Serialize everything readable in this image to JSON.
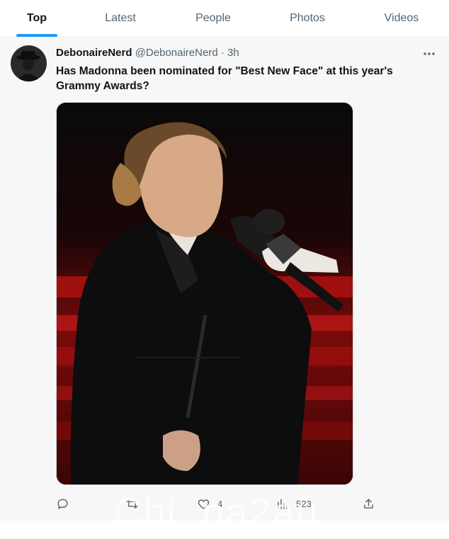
{
  "tabs": [
    {
      "label": "Top",
      "active": true
    },
    {
      "label": "Latest",
      "active": false
    },
    {
      "label": "People",
      "active": false
    },
    {
      "label": "Photos",
      "active": false
    },
    {
      "label": "Videos",
      "active": false
    }
  ],
  "tweet": {
    "display_name": "DebonaireNerd",
    "handle": "@DebonaireNerd",
    "separator": "·",
    "time": "3h",
    "text": "Has Madonna been nominated for \"Best New Face\" at this year's Grammy Awards?",
    "actions": {
      "reply_count": "",
      "retweet_count": "",
      "like_count": "4",
      "views_count": "523"
    }
  },
  "watermark": "Chi..na2au",
  "icons": {
    "more": "more-icon",
    "reply": "reply-icon",
    "retweet": "retweet-icon",
    "like": "heart-icon",
    "views": "views-icon",
    "share": "share-icon"
  },
  "colors": {
    "accent": "#1d9bf0",
    "secondary_text": "#536471",
    "primary_text": "#0f1419"
  }
}
